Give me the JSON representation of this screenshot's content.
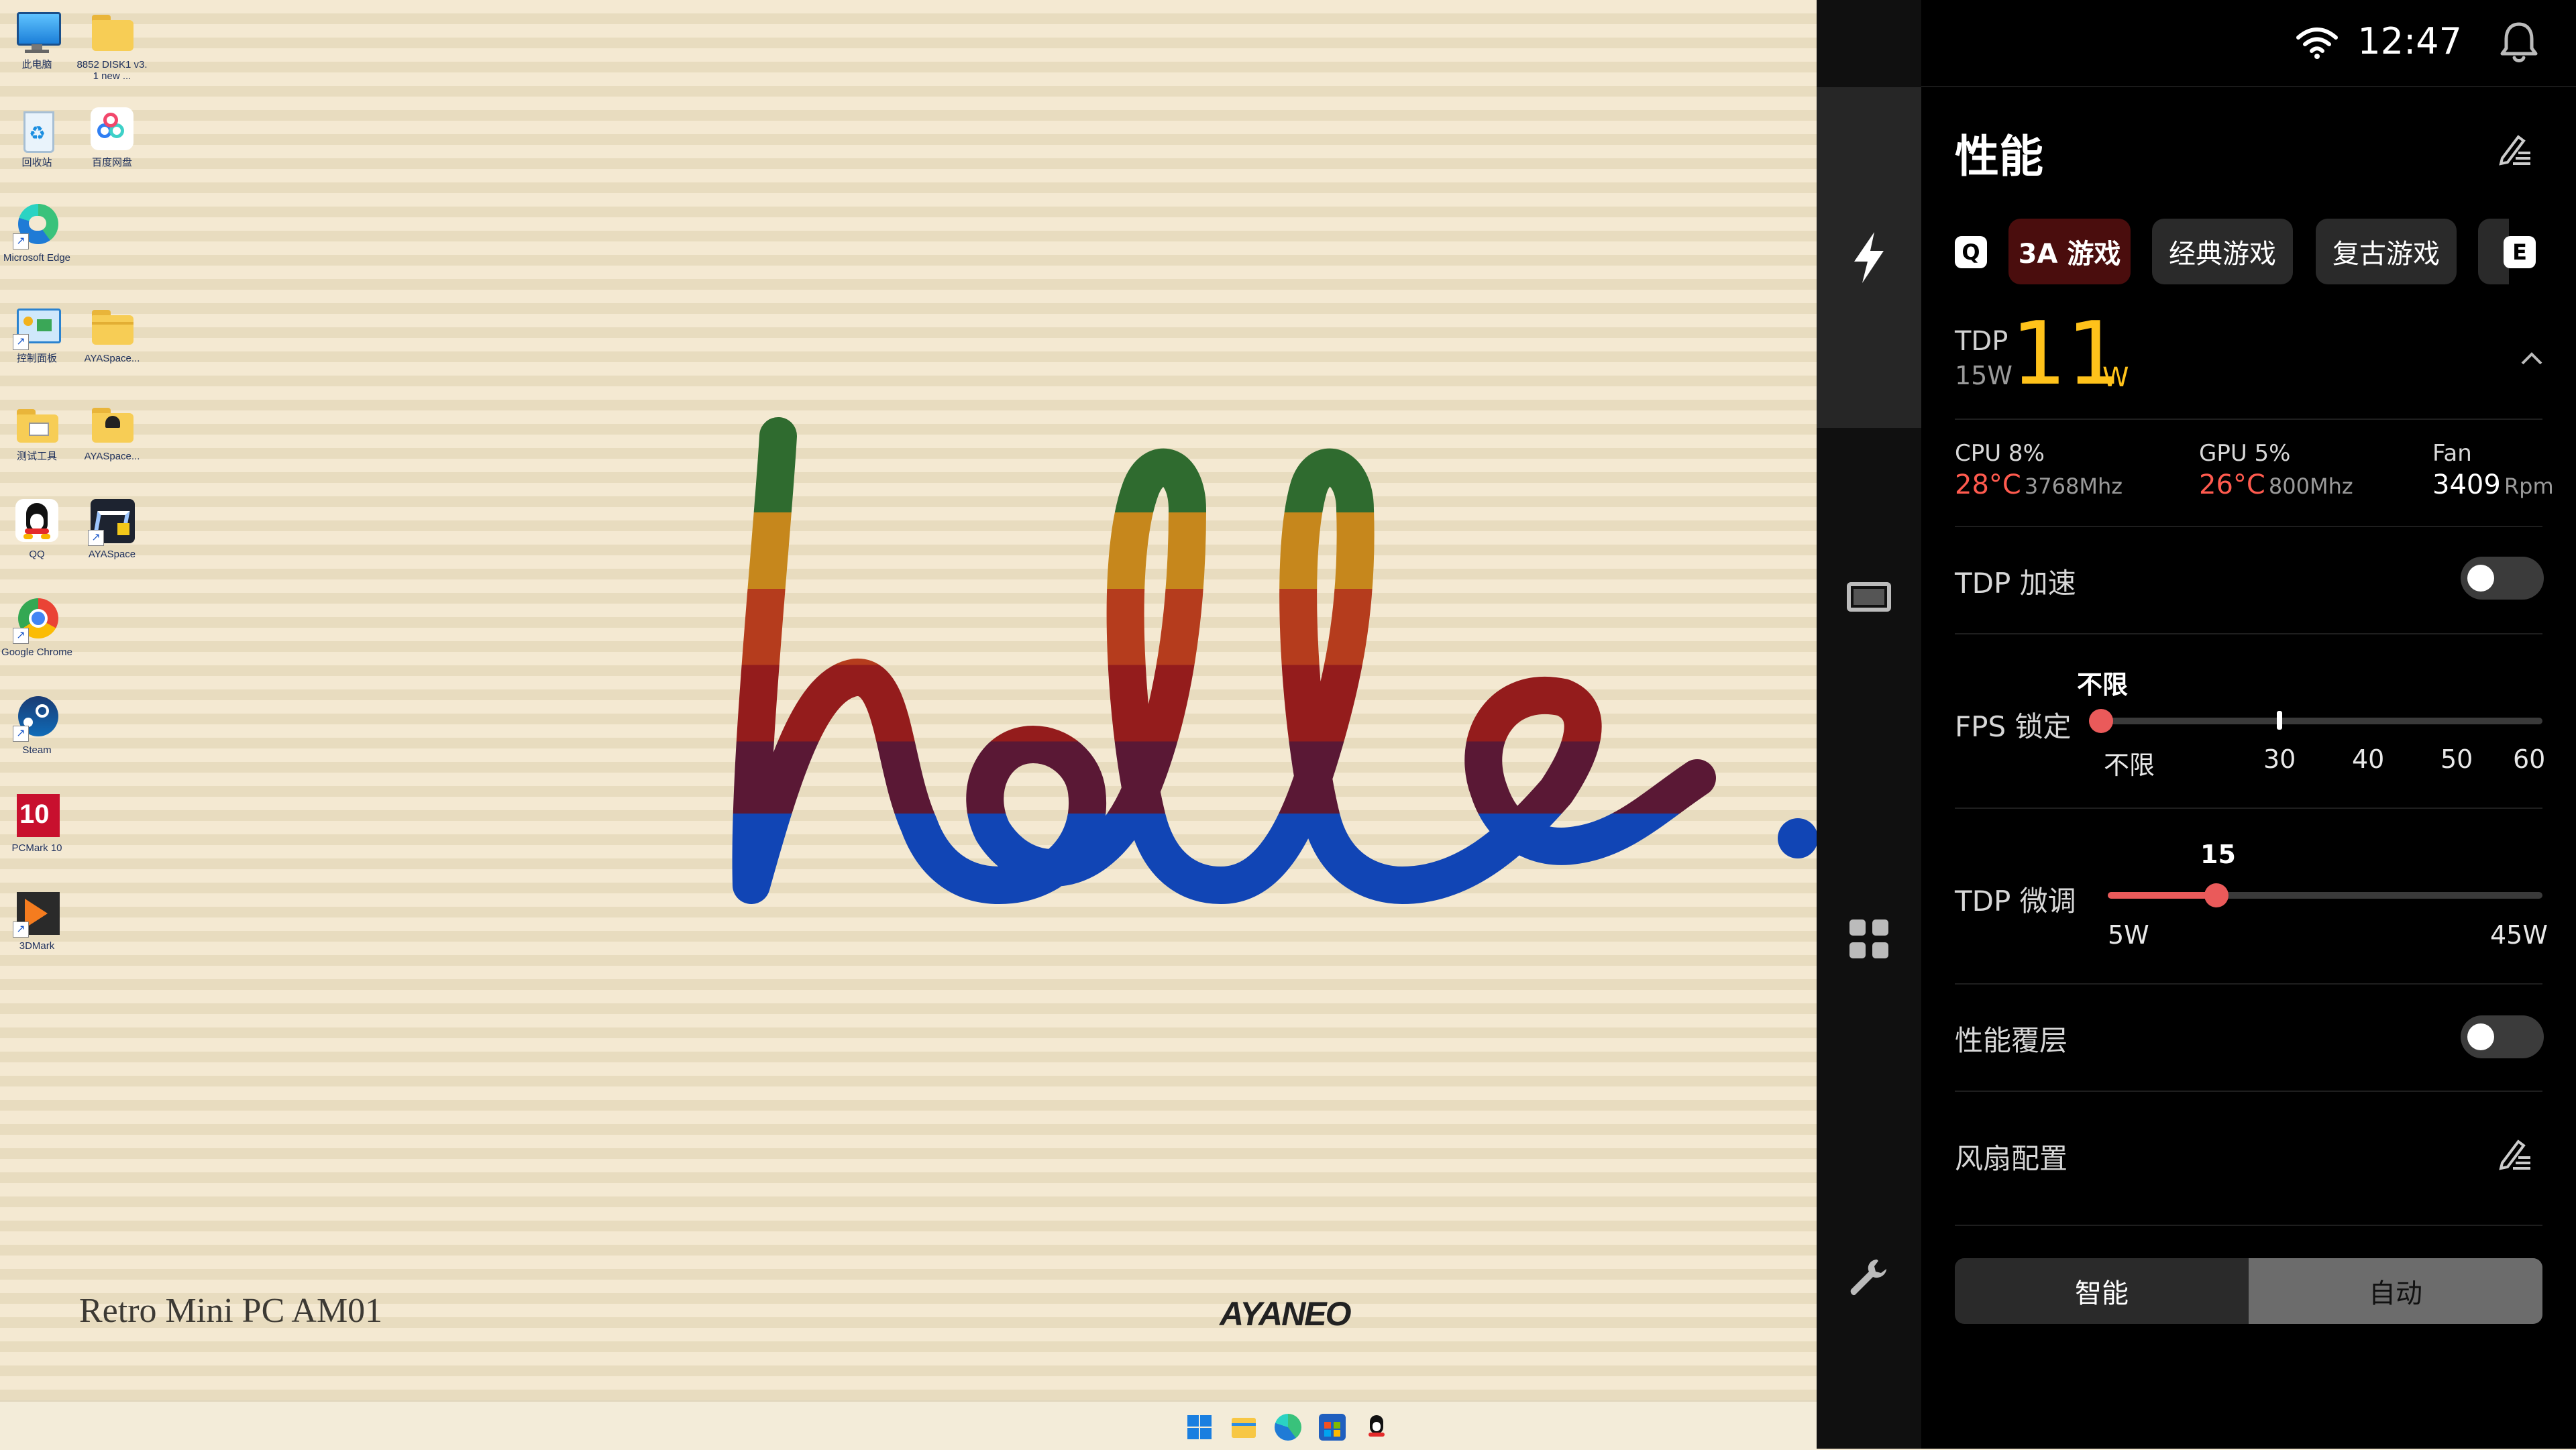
{
  "desktop": {
    "icons": [
      {
        "label": "此电脑"
      },
      {
        "label": "8852 DISK1 v3.1 new ..."
      },
      {
        "label": "回收站"
      },
      {
        "label": "百度网盘"
      },
      {
        "label": "Microsoft Edge"
      },
      {
        "label": "控制面板"
      },
      {
        "label": "AYASpace..."
      },
      {
        "label": "测试工具"
      },
      {
        "label": "AYASpace..."
      },
      {
        "label": "QQ"
      },
      {
        "label": "AYASpace"
      },
      {
        "label": "Google Chrome"
      },
      {
        "label": "Steam"
      },
      {
        "label": "PCMark 10"
      },
      {
        "label": "3DMark"
      }
    ],
    "wallpaper_text": "hello.",
    "brand_left": "Retro Mini PC AM01",
    "brand_right": "AYANEO"
  },
  "status": {
    "time": "12:47"
  },
  "panel": {
    "title": "性能",
    "mode_tabs": {
      "left_key": "Q",
      "right_key": "E",
      "items": [
        {
          "label": "3A 游戏",
          "active": true
        },
        {
          "label": "经典游戏",
          "active": false
        },
        {
          "label": "复古游戏",
          "active": false
        }
      ]
    },
    "tdp": {
      "label": "TDP",
      "base": "15W",
      "value": "11",
      "unit": "W"
    },
    "stats": {
      "cpu": {
        "label": "CPU 8%",
        "temp": "28°C",
        "freq": "3768Mhz"
      },
      "gpu": {
        "label": "GPU 5%",
        "temp": "26°C",
        "freq": "800Mhz"
      },
      "fan": {
        "label": "Fan",
        "value": "3409",
        "unit": "Rpm"
      }
    },
    "tdp_boost": {
      "label": "TDP 加速",
      "on": false
    },
    "fps_lock": {
      "label": "FPS 锁定",
      "current": "不限",
      "ticks": [
        "不限",
        "30",
        "40",
        "50",
        "60"
      ]
    },
    "tdp_tune": {
      "label": "TDP 微调",
      "current": "15",
      "min": "5W",
      "max": "45W",
      "level_fraction": 0.25
    },
    "overlay": {
      "label": "性能覆层",
      "on": false
    },
    "fan_config": {
      "label": "风扇配置",
      "options": [
        {
          "label": "智能",
          "active": false
        },
        {
          "label": "自动",
          "active": true
        }
      ]
    }
  },
  "colors": {
    "accent_red": "#ea5a5a",
    "tdp_yellow": "#ffc21a",
    "active_tab": "#4a0d0d"
  }
}
